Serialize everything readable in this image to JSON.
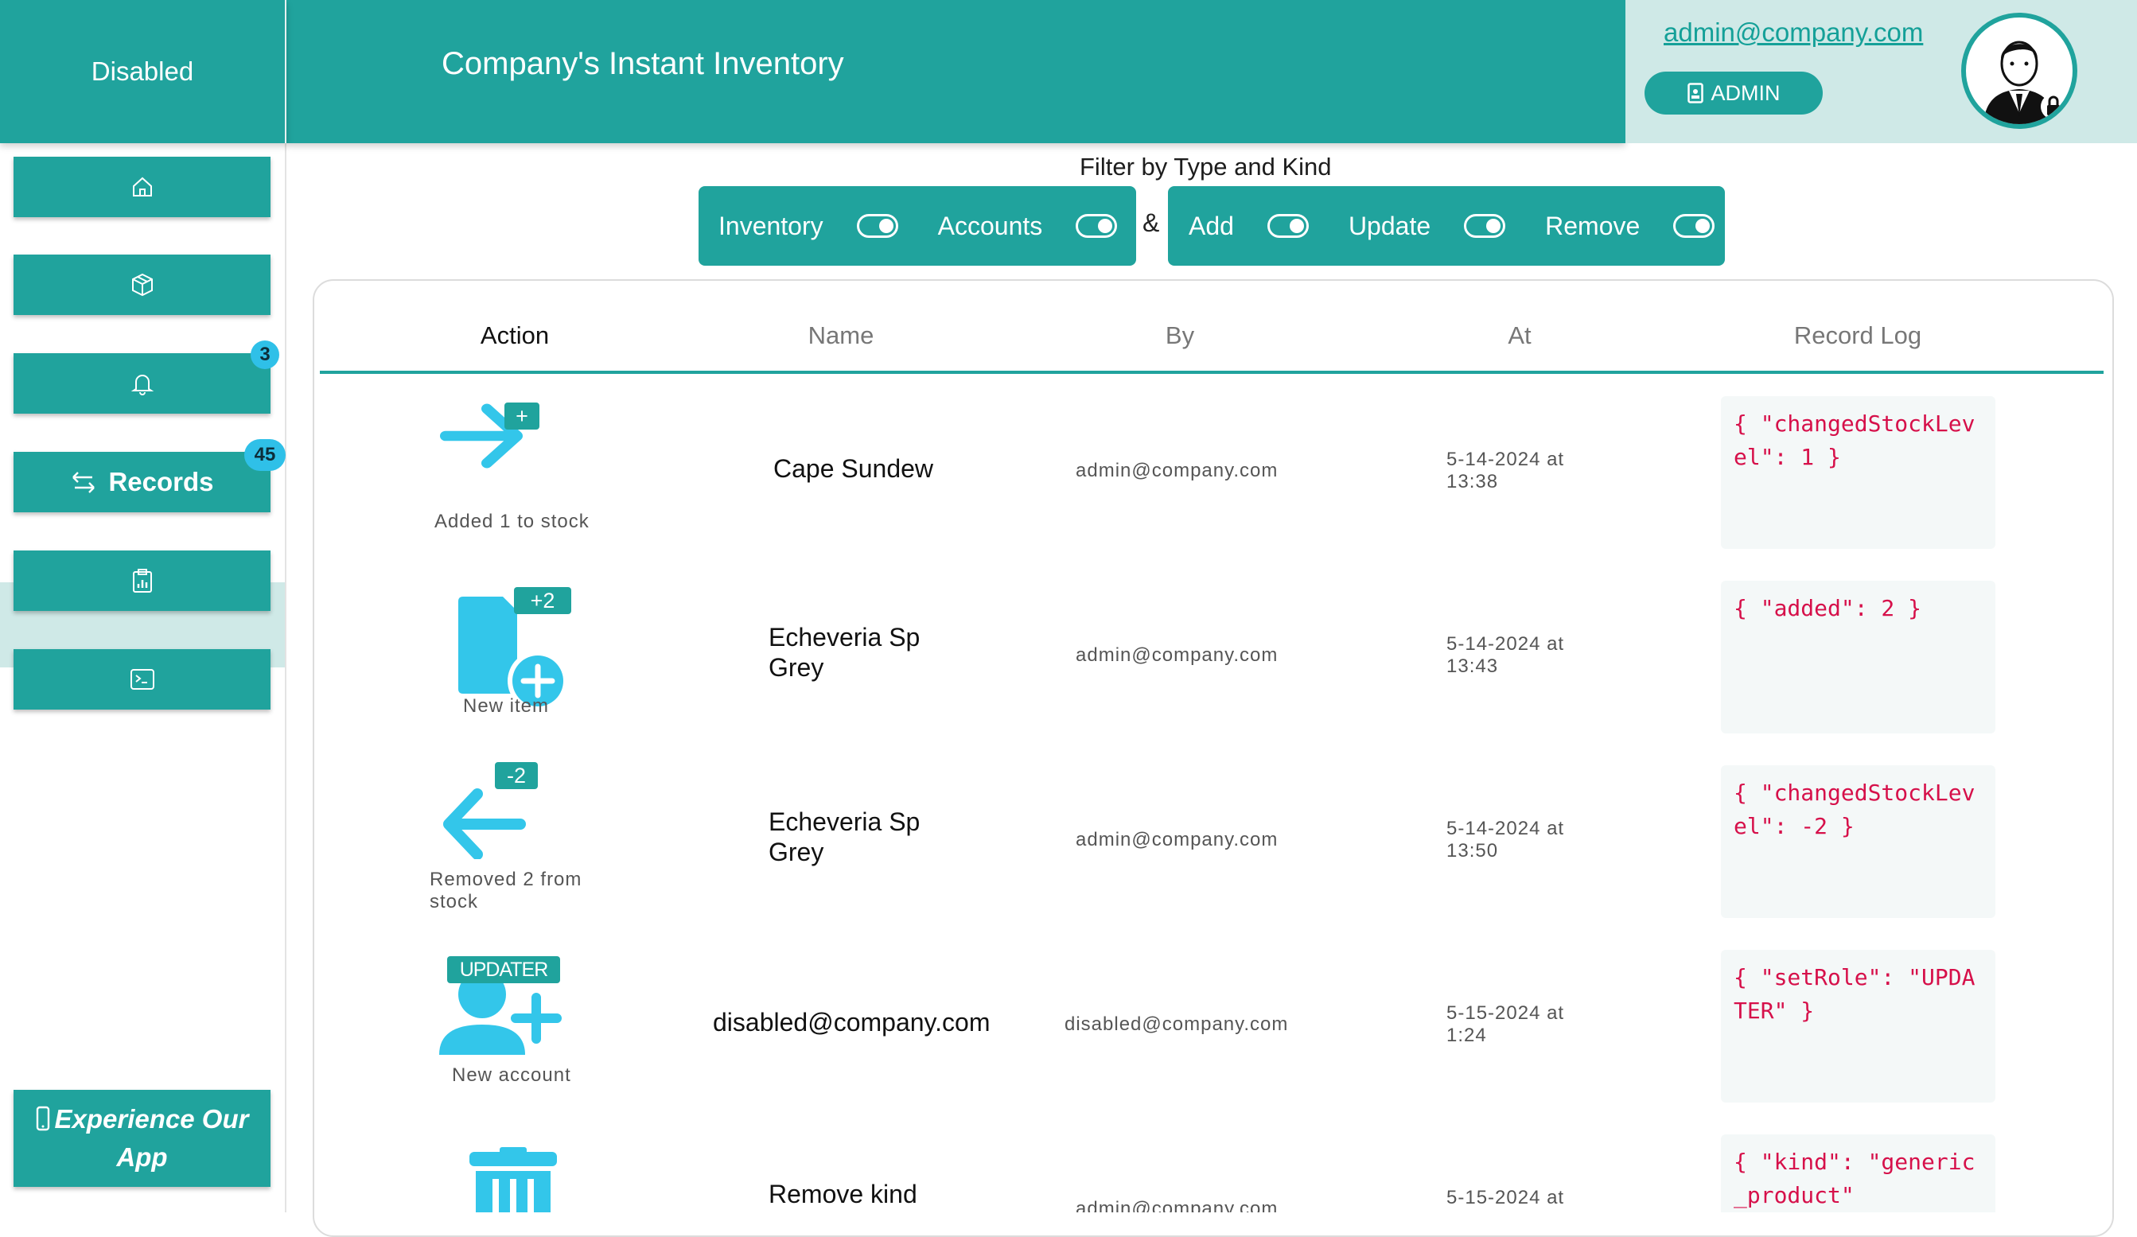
{
  "header": {
    "status_label": "Disabled",
    "app_title": "Company's Instant Inventory",
    "user_email": "admin@company.com",
    "role_label": "ADMIN"
  },
  "sidebar": {
    "items": [
      {
        "name": "home",
        "icon": "home-icon",
        "label": ""
      },
      {
        "name": "inventory",
        "icon": "box-icon",
        "label": ""
      },
      {
        "name": "notifications",
        "icon": "bell-icon",
        "label": "",
        "badge": "3"
      },
      {
        "name": "records",
        "icon": "swap-arrows-icon",
        "label": "Records",
        "badge": "45",
        "active": true
      },
      {
        "name": "reports",
        "icon": "clipboard-chart-icon",
        "label": ""
      },
      {
        "name": "console",
        "icon": "terminal-icon",
        "label": ""
      }
    ],
    "cta_label": "Experience Our App"
  },
  "filters": {
    "title": "Filter by Type and Kind",
    "separator": "&",
    "types": [
      {
        "label": "Inventory",
        "on": true
      },
      {
        "label": "Accounts",
        "on": true
      }
    ],
    "kinds": [
      {
        "label": "Add",
        "on": true
      },
      {
        "label": "Update",
        "on": true
      },
      {
        "label": "Remove",
        "on": true
      }
    ]
  },
  "table": {
    "columns": [
      "Action",
      "Name",
      "By",
      "At",
      "Record Log"
    ],
    "rows": [
      {
        "icon": "arrow-right-icon",
        "icon_badge": "+",
        "caption": "Added 1 to stock",
        "name": "Cape Sundew",
        "by": "admin@company.com",
        "at": "5-14-2024 at 13:38",
        "log": "{ \"changedStockLevel\": 1 }"
      },
      {
        "icon": "new-file-icon",
        "icon_badge": "+2",
        "caption": "New item",
        "name": "Echeveria Sp Grey",
        "by": "admin@company.com",
        "at": "5-14-2024 at 13:43",
        "log": "{ \"added\": 2 }"
      },
      {
        "icon": "arrow-left-icon",
        "icon_badge": "-2",
        "caption": "Removed 2 from stock",
        "name": "Echeveria Sp Grey",
        "by": "admin@company.com",
        "at": "5-14-2024 at 13:50",
        "log": "{ \"changedStockLevel\": -2 }"
      },
      {
        "icon": "add-user-icon",
        "icon_badge": "UPDATER",
        "caption": "New account",
        "name": "disabled@company.com",
        "by": "disabled@company.com",
        "at": "5-15-2024 at 1:24",
        "log": "{ \"setRole\": \"UPDATER\" }"
      },
      {
        "icon": "trash-icon",
        "icon_badge": "",
        "caption": "",
        "name": "Remove kind",
        "by": "admin@company.com",
        "at": "5-15-2024 at",
        "log": "{ \"kind\": \"generic_product\""
      }
    ]
  },
  "colors": {
    "accent": "#20a39d",
    "accent_light": "#cfe9e7",
    "icon_blue": "#33c6ea",
    "badge_blue": "#2fc0e8",
    "log_text": "#d6104a"
  }
}
